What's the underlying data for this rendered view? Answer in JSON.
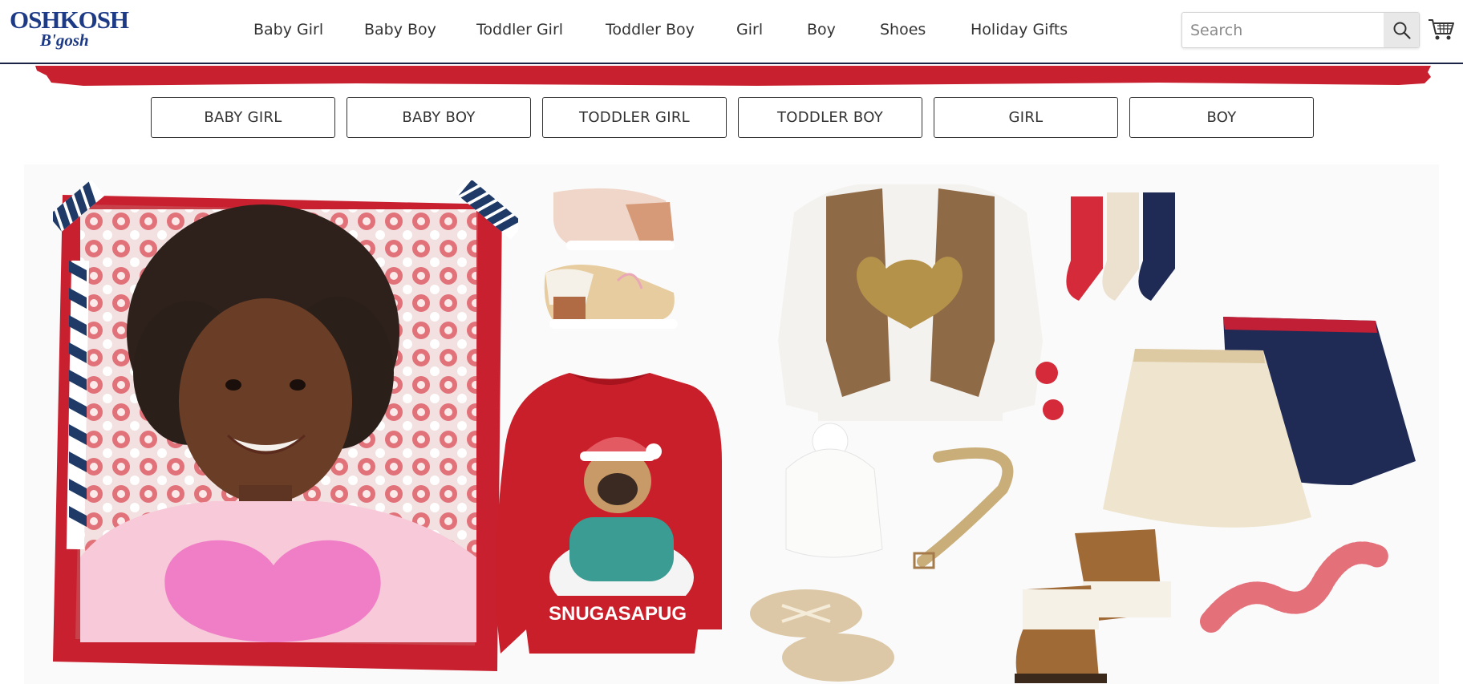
{
  "header": {
    "logo": {
      "line1": "OSHKOSH",
      "line2": "B'gosh"
    },
    "nav": [
      "Baby Girl",
      "Baby Boy",
      "Toddler Girl",
      "Toddler Boy",
      "Girl",
      "Boy",
      "Shoes",
      "Holiday Gifts"
    ],
    "search": {
      "placeholder": "Search",
      "icon": "search-icon"
    },
    "cart": {
      "icon": "shopping-cart-icon"
    }
  },
  "categories": [
    "BABY GIRL",
    "BABY BOY",
    "TODDLER GIRL",
    "TODDLER BOY",
    "GIRL",
    "BOY"
  ],
  "hero": {
    "sweater_text": "SNUGASAPUG"
  },
  "colors": {
    "brand_navy": "#1d3a86",
    "banner_red": "#c8202f",
    "header_border": "#1b2447",
    "sweater_red": "#c91f2b",
    "heart_pink": "#f07ec6"
  }
}
